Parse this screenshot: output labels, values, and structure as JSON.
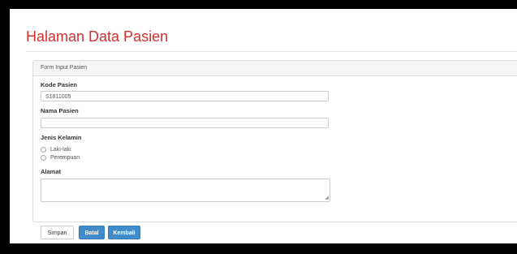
{
  "header": {
    "title": "Halaman Data Pasien"
  },
  "form": {
    "panel_title": "Form Input Pasien",
    "kode_label": "Kode Pasien",
    "kode_value": "S1811005",
    "nama_label": "Nama Pasien",
    "nama_value": "",
    "jk_label": "Jenis Kelamin",
    "jk_options": [
      "Laki-laki",
      "Perempuan"
    ],
    "alamat_label": "Alamat",
    "alamat_value": ""
  },
  "buttons": {
    "simpan": "Simpan",
    "batal": "Batal",
    "kembali": "Kembali"
  },
  "colors": {
    "title": "#d32f2f",
    "primary": "#428bca"
  }
}
